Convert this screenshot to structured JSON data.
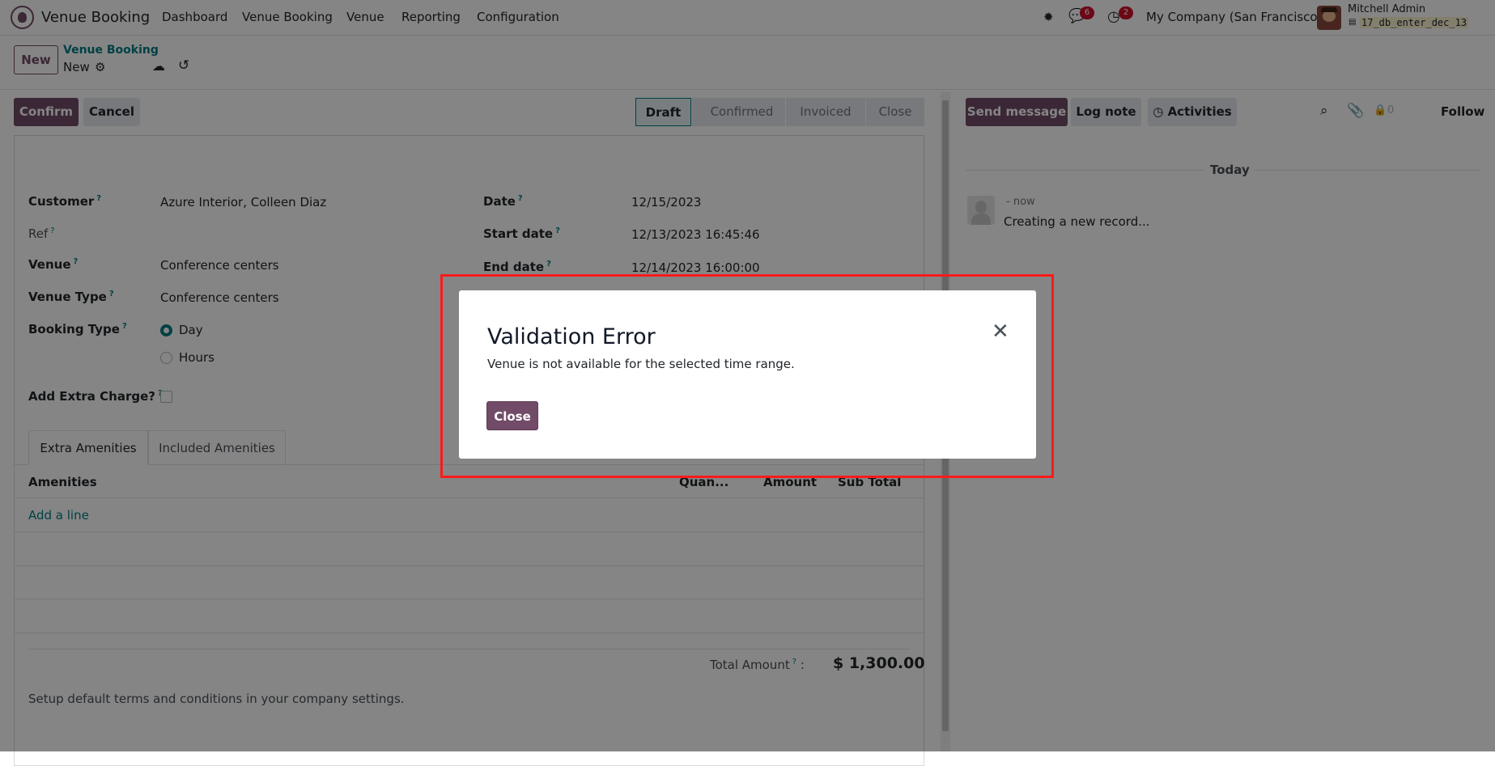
{
  "nav": {
    "app_name": "Venue Booking",
    "menu": [
      "Dashboard",
      "Venue Booking",
      "Venue",
      "Reporting",
      "Configuration"
    ],
    "messages_count": "6",
    "activities_count": "2",
    "company": "My Company (San Francisco)",
    "user_name": "Mitchell Admin",
    "db_name": "17_db_enter_dec_13"
  },
  "control_panel": {
    "new_button": "New",
    "breadcrumb_parent": "Venue Booking",
    "record_name": "New"
  },
  "statusbar": {
    "confirm_button": "Confirm",
    "cancel_button": "Cancel",
    "stages": [
      "Draft",
      "Confirmed",
      "Invoiced",
      "Close"
    ],
    "active_stage": "Draft"
  },
  "form": {
    "left": [
      {
        "label": "Customer",
        "value": "Azure Interior, Colleen Diaz"
      },
      {
        "label": "Ref",
        "value": ""
      },
      {
        "label": "Venue",
        "value": "Conference centers"
      },
      {
        "label": "Venue Type",
        "value": "Conference centers"
      }
    ],
    "right": [
      {
        "label": "Date",
        "value": "12/15/2023"
      },
      {
        "label": "Start date",
        "value": "12/13/2023 16:45:46"
      },
      {
        "label": "End date",
        "value": "12/14/2023 16:00:00"
      }
    ],
    "booking_type_label": "Booking Type",
    "booking_options": [
      "Day",
      "Hours"
    ],
    "booking_selected": "Day",
    "extra_charge_label": "Add Extra Charge?",
    "extra_charge_checked": false,
    "tabs": [
      "Extra Amenities",
      "Included Amenities"
    ],
    "active_tab": "Extra Amenities",
    "table_headers": [
      "Amenities",
      "Quan...",
      "Amount",
      "Sub Total"
    ],
    "add_line": "Add a line",
    "total_label": "Total Amount",
    "total_value": "$ 1,300.00",
    "terms_note": "Setup default terms and conditions in your company settings."
  },
  "chatter": {
    "send_message": "Send message",
    "log_note": "Log note",
    "activities": "Activities",
    "followers_count": "0",
    "follow": "Follow",
    "today": "Today",
    "message_time": "- now",
    "message_text": "Creating a new record..."
  },
  "dialog": {
    "title": "Validation Error",
    "message": "Venue is not available for the selected time range.",
    "close_button": "Close"
  },
  "colors": {
    "primary": "#714B67",
    "link": "#017e84",
    "badge": "#d0112b",
    "highlight": "#ff1a1a"
  }
}
